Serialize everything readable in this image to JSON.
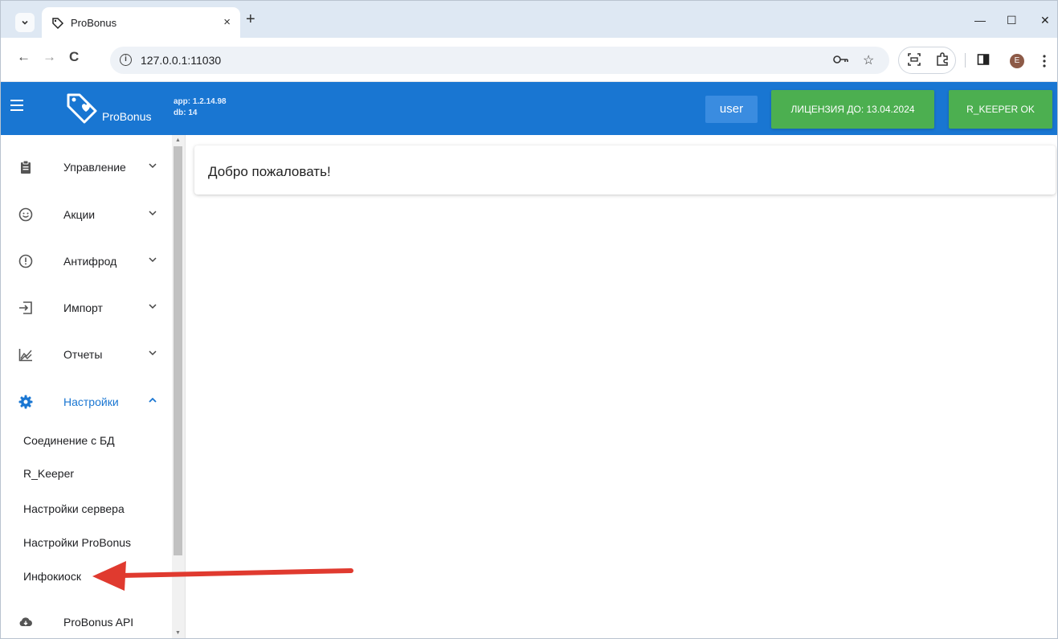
{
  "browser": {
    "tab_title": "ProBonus",
    "tab_close": "×",
    "new_tab": "+",
    "url": "127.0.0.1:11030",
    "win_min": "—",
    "win_max": "☐",
    "win_close": "✕",
    "back": "←",
    "forward": "→",
    "reload": "C",
    "profile_initial": "E"
  },
  "header": {
    "brand": "ProBonus",
    "app_version": "app: 1.2.14.98",
    "db_version": "db: 14",
    "user_label": "user",
    "license_label": "ЛИЦЕНЗИЯ ДО: 13.04.2024",
    "rkeeper_status": "R_KEEPER OK"
  },
  "sidebar": {
    "items": [
      {
        "label": "Управление",
        "icon": "clipboard-icon"
      },
      {
        "label": "Акции",
        "icon": "smile-icon"
      },
      {
        "label": "Антифрод",
        "icon": "alert-circle-icon"
      },
      {
        "label": "Импорт",
        "icon": "import-icon"
      },
      {
        "label": "Отчеты",
        "icon": "chart-icon"
      },
      {
        "label": "Настройки",
        "icon": "gear-icon"
      },
      {
        "label": "ProBonus API",
        "icon": "cloud-icon"
      }
    ],
    "settings_subitems": [
      "Соединение с БД",
      "R_Keeper",
      "Настройки сервера",
      "Настройки ProBonus",
      "Инфокиоск"
    ]
  },
  "main": {
    "welcome": "Добро пожаловать!"
  },
  "colors": {
    "app_bar": "#1976d2",
    "accent_green": "#4caf50",
    "annotation_arrow": "#e03a2f"
  }
}
